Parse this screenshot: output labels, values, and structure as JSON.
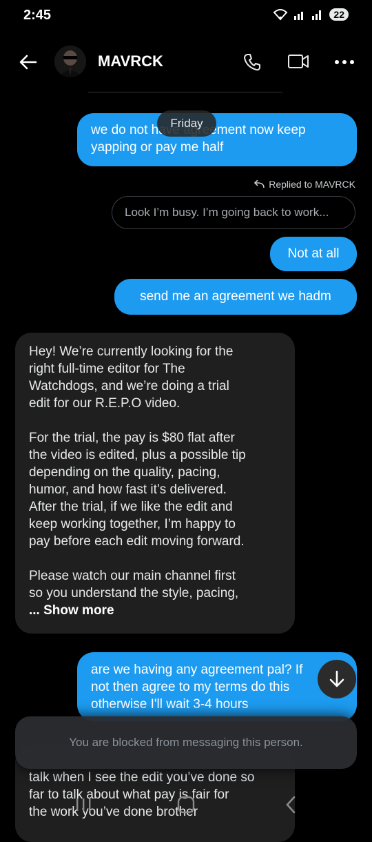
{
  "status": {
    "time": "2:45",
    "battery": "22"
  },
  "header": {
    "back_label": "back",
    "title": "MAVRCK"
  },
  "separator": {},
  "messages": {
    "m1_line1": "we do not have agreement now keep",
    "m1_line2": "yapping or pay me half",
    "day_label": "Friday",
    "replied_to": "Replied to MAVRCK",
    "quoted": "Look I’m busy. I’m going back to work...",
    "m2": "Not at all",
    "m3": "send me an agreement we hadm",
    "in_lines": [
      "Hey! We’re currently looking for the",
      "right full-time editor for The",
      "Watchdogs, and we’re doing a trial",
      "edit for our R.E.P.O video.",
      "",
      "For the trial, the pay is $80 flat after",
      "the video is edited, plus a possible tip",
      "depending on the quality, pacing,",
      "humor, and how fast it’s delivered.",
      "After the trial, if we like the edit and",
      "keep working together, I’m happy to",
      "pay before each edit moving forward.",
      "",
      "Please watch our main channel first",
      "so you understand the style, pacing,"
    ],
    "show_more": "... Show more",
    "m4_line1": "are we having any agreement pal? If",
    "m4_line2": "not then agree to my terms do this",
    "m4_line3": "otherwise I'll wait 3-4 hours",
    "in2_line1": "talk when I see the edit you’ve done so",
    "in2_line2": "far to talk about what pay is fair for",
    "in2_line3": "the work you’ve done brother"
  },
  "composer": {
    "blocked_text": "You are blocked from messaging this person."
  },
  "colors": {
    "accent": "#1d9bf0",
    "incoming": "#1f1f1f",
    "background": "#000000"
  }
}
